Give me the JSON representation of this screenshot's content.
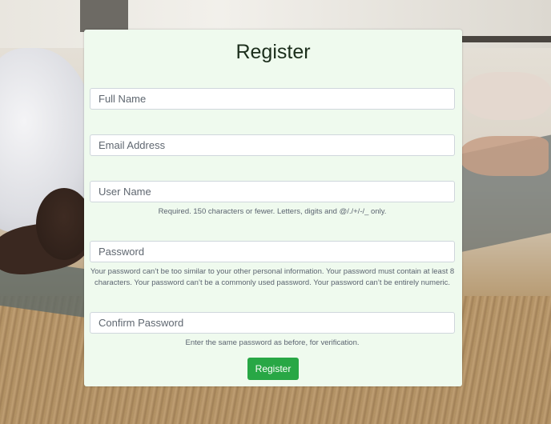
{
  "form": {
    "title": "Register",
    "full_name": {
      "placeholder": "Full Name",
      "value": ""
    },
    "email": {
      "placeholder": "Email Address",
      "value": ""
    },
    "username": {
      "placeholder": "User Name",
      "value": "",
      "help": "Required. 150 characters or fewer. Letters, digits and @/./+/-/_ only."
    },
    "password": {
      "placeholder": "Password",
      "value": "",
      "help": "Your password can’t be too similar to your other personal information. Your password must contain at least 8 characters. Your password can’t be a commonly used password. Your password can’t be entirely numeric."
    },
    "confirm_password": {
      "placeholder": "Confirm Password",
      "value": "",
      "help": "Enter the same password as before, for verification."
    },
    "submit_label": "Register"
  },
  "colors": {
    "card_background": "#effaee",
    "button": "#28a745",
    "button_text": "#ffffff"
  }
}
